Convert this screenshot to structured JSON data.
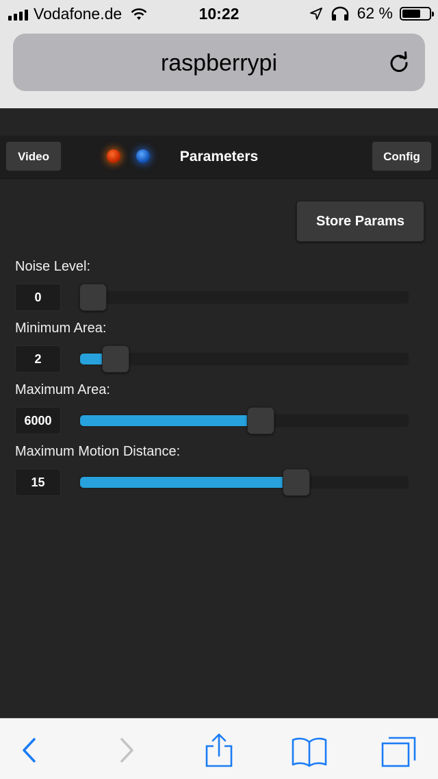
{
  "status_bar": {
    "carrier": "Vodafone.de",
    "time": "10:22",
    "battery_percent": "62 %",
    "icons": [
      "signal-bars-icon",
      "wifi-icon",
      "location-arrow-icon",
      "headphones-icon",
      "battery-icon"
    ]
  },
  "browser": {
    "url": "raspberrypi",
    "reload_icon": "reload-icon",
    "toolbar_icons": [
      "back-icon",
      "forward-icon",
      "share-icon",
      "bookmarks-icon",
      "tabs-icon"
    ]
  },
  "header": {
    "video_label": "Video",
    "title": "Parameters",
    "config_label": "Config",
    "led_colors": [
      "#e04a10",
      "#2a7de0"
    ]
  },
  "store_label": "Store Params",
  "parameters": [
    {
      "label": "Noise Level:",
      "value": "0",
      "fraction": 0.0,
      "filled": false
    },
    {
      "label": "Minimum Area:",
      "value": "2",
      "fraction": 0.11,
      "filled": true
    },
    {
      "label": "Maximum Area:",
      "value": "6000",
      "fraction": 0.55,
      "filled": true
    },
    {
      "label": "Maximum Motion Distance:",
      "value": "15",
      "fraction": 0.66,
      "filled": true
    }
  ],
  "colors": {
    "accent": "#27a2dc",
    "background": "#252525",
    "ios_blue": "#1a7cf5"
  }
}
